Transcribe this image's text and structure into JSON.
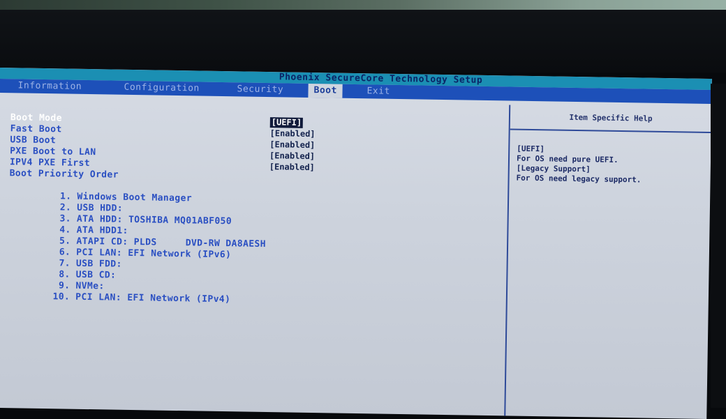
{
  "header": {
    "title": "Phoenix SecureCore Technology Setup"
  },
  "tabs": [
    {
      "label": "Information",
      "active": false
    },
    {
      "label": "Configuration",
      "active": false
    },
    {
      "label": "Security",
      "active": false
    },
    {
      "label": "Boot",
      "active": true
    },
    {
      "label": "Exit",
      "active": false
    }
  ],
  "settings": [
    {
      "label": "Boot Mode",
      "value": "[UEFI]",
      "selected": true
    },
    {
      "label": "Fast Boot",
      "value": "[Enabled]",
      "selected": false
    },
    {
      "label": "USB Boot",
      "value": "[Enabled]",
      "selected": false
    },
    {
      "label": "PXE Boot to LAN",
      "value": "[Enabled]",
      "selected": false
    },
    {
      "label": "IPV4 PXE First",
      "value": "[Enabled]",
      "selected": false
    }
  ],
  "boot_priority": {
    "heading": "Boot Priority Order",
    "items": [
      {
        "num": "1.",
        "label": "Windows Boot Manager"
      },
      {
        "num": "2.",
        "label": "USB HDD:"
      },
      {
        "num": "3.",
        "label": "ATA HDD: TOSHIBA MQ01ABF050"
      },
      {
        "num": "4.",
        "label": "ATA HDD1:"
      },
      {
        "num": "5.",
        "label": "ATAPI CD: PLDS     DVD-RW DA8AESH"
      },
      {
        "num": "6.",
        "label": "PCI LAN: EFI Network (IPv6)"
      },
      {
        "num": "7.",
        "label": "USB FDD:"
      },
      {
        "num": "8.",
        "label": "USB CD:"
      },
      {
        "num": "9.",
        "label": "NVMe:"
      },
      {
        "num": "10.",
        "label": "PCI LAN: EFI Network (IPv4)"
      }
    ]
  },
  "help": {
    "title": "Item Specific Help",
    "lines": [
      "[UEFI]",
      "For OS need pure UEFI.",
      "[Legacy Support]",
      "For OS need legacy support."
    ]
  },
  "colors": {
    "tab_bar": "#1d50b9",
    "title_strip": "#1b8fb3",
    "panel_background": "#cfd5df",
    "item_text": "#2a4fc2"
  }
}
